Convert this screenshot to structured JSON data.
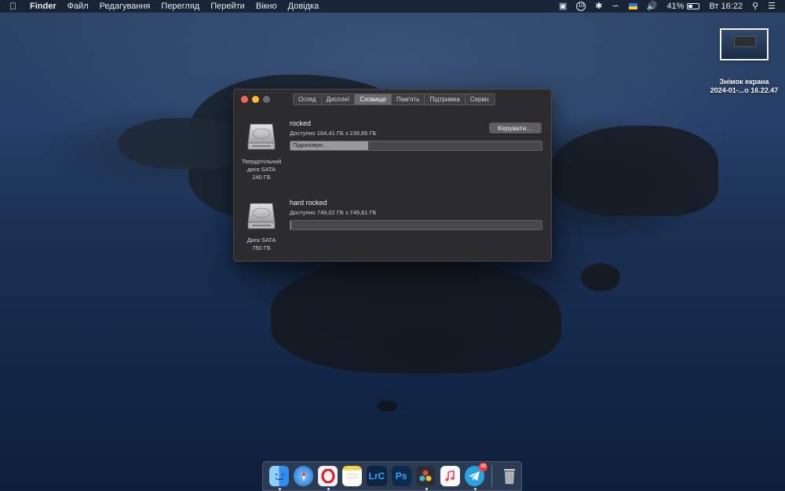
{
  "menubar": {
    "apple": "",
    "app_name": "Finder",
    "items": [
      "Файл",
      "Редагування",
      "Перегляд",
      "Перейти",
      "Вікно",
      "Довідка"
    ],
    "status": {
      "telegram_badge": "10",
      "battery": "41%",
      "clock": "Вт 16:22"
    }
  },
  "desktop": {
    "file_line1": "Знімок екрана",
    "file_line2": "2024-01-...о 16.22.47"
  },
  "window": {
    "tabs": [
      "Огляд",
      "Дисплеї",
      "Сховище",
      "Пам'ять",
      "Підтримка",
      "Сервіс"
    ],
    "active_tab": "Сховище",
    "manage_button": "Керувати…",
    "disks": [
      {
        "caption_line1": "Твердотільний",
        "caption_line2": "диск SATA",
        "caption_line3": "240 ГБ",
        "volume": "rocked",
        "available": "Доступно 164,41 ГБ з 239,85 ГБ",
        "bar_text": "Підраховую…",
        "used_fraction": 0.31
      },
      {
        "caption_line1": "Диск SATA",
        "caption_line2": "750 ГБ",
        "volume": "hard rocked",
        "available": "Доступно 749,02 ГБ з 749,81 ГБ",
        "used_fraction": 0.001
      }
    ]
  },
  "dock": {
    "apps": [
      {
        "name": "Finder",
        "icon": "finder-icon",
        "color": "#2f8ef0"
      },
      {
        "name": "Safari",
        "icon": "safari-icon",
        "color": "#1e7bde"
      },
      {
        "name": "Opera",
        "icon": "opera-icon",
        "color": "#e9e9ea"
      },
      {
        "name": "Notes",
        "icon": "notes-icon",
        "color": "#f5e17a"
      },
      {
        "name": "Lightroom Classic",
        "icon": "lrc-icon",
        "label": "LrC",
        "color": "#0d2440"
      },
      {
        "name": "Photoshop",
        "icon": "ps-icon",
        "label": "Ps",
        "color": "#0e2a4a"
      },
      {
        "name": "DaVinci Resolve",
        "icon": "davinci-icon",
        "color": "#2b2f36"
      },
      {
        "name": "Music",
        "icon": "music-icon",
        "color": "#f5f5f7"
      },
      {
        "name": "Telegram",
        "icon": "telegram-icon",
        "color": "#2aa3e0",
        "badge": "10"
      },
      {
        "name": "Trash",
        "icon": "trash-icon",
        "color": "#8a8f96"
      }
    ]
  }
}
